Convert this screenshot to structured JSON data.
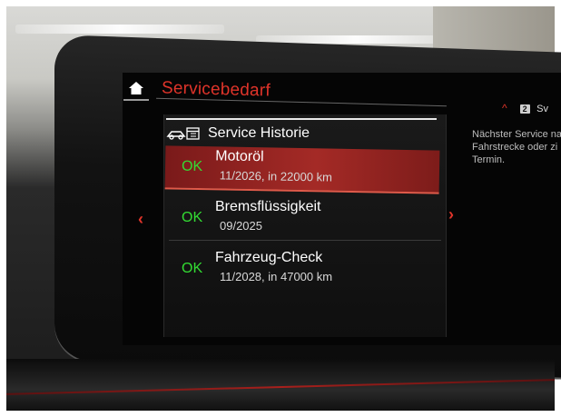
{
  "header": {
    "title": "Servicebedarf",
    "right_badge": "2",
    "right_text": "Sv"
  },
  "panel": {
    "title": "Service Historie",
    "icon": "car-calendar-icon"
  },
  "items": [
    {
      "status": "OK",
      "name": "Motoröl",
      "detail": "11/2026, in 22000 km",
      "selected": true
    },
    {
      "status": "OK",
      "name": "Bremsflüssigkeit",
      "detail": "09/2025",
      "selected": false
    },
    {
      "status": "OK",
      "name": "Fahrzeug-Check",
      "detail": "11/2028, in 47000 km",
      "selected": false
    }
  ],
  "side": {
    "text": "Nächster Service na\nFahrstrecke oder zi\nTermin."
  },
  "colors": {
    "accent_red": "#e0342a",
    "ok_green": "#33dd33",
    "selection": "#a42a26"
  }
}
